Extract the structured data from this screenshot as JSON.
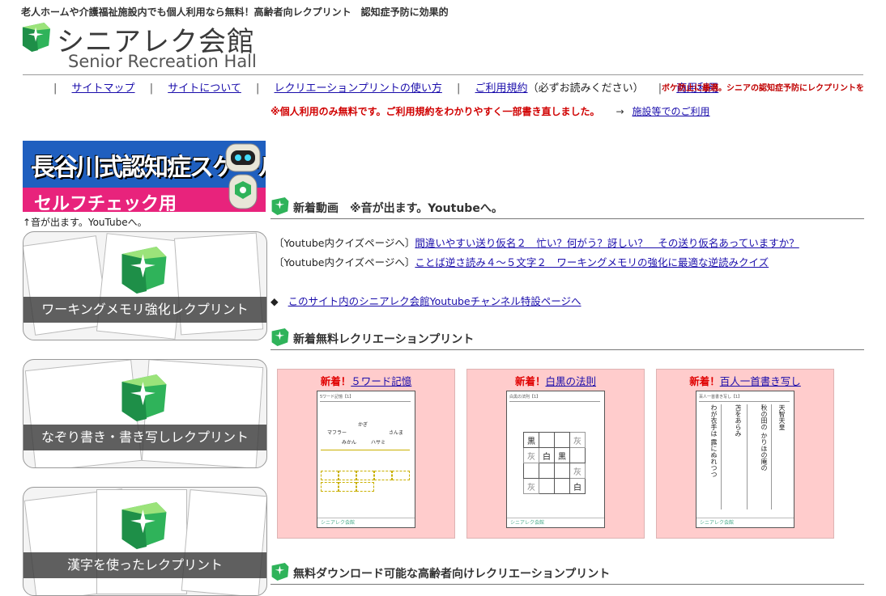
{
  "header": {
    "tagline": "老人ホームや介護福祉施設内でも個人利用なら無料！高齢者向レクプリント　認知症予防に効果的",
    "logo_title": "シニアレク会館",
    "logo_sub": "Senior Recreation Hall"
  },
  "nav": {
    "items": [
      {
        "label": "サイトマップ"
      },
      {
        "label": "サイトについて"
      },
      {
        "label": "レクリエーションプリントの使い方"
      },
      {
        "label": "ご利用規約",
        "note": "（必ずお読みください）"
      },
      {
        "label": "商用利用"
      }
    ],
    "notice_red": "ボケ防止に最適。シニアの認知症予防にレクプリントを",
    "notice2_red": "※個人利用のみ無料です。ご利用規約をわかりやすく一部書き直しました。",
    "notice2_arrow": "→",
    "notice2_link": "施設等でのご利用"
  },
  "sidebar": {
    "hasegawa_title": "長谷川式認知症スケール",
    "hasegawa_sub": "セルフチェック用",
    "yt_caption": "↑音が出ます。YouTubeへ。",
    "banners": [
      {
        "label": "ワーキングメモリ強化レクプリント"
      },
      {
        "label": "なぞり書き・書き写しレクプリント"
      },
      {
        "label": "漢字を使ったレクプリント"
      }
    ]
  },
  "main": {
    "section_video": "新着動画　※音が出ます。Youtubeへ。",
    "videos": [
      {
        "prefix": "〔Youtube内クイズページへ〕",
        "link": "間違いやすい送り仮名２　忙い？何がう？訝しい？　その送り仮名あっていますか？"
      },
      {
        "prefix": "〔Youtube内クイズページへ〕",
        "link": "ことば逆さ読み４～５文字２　ワーキングメモリの強化に最適な逆読みクイズ"
      }
    ],
    "yt_channel_bullet": "◆",
    "yt_channel_link": "このサイト内のシニアレク会館Youtubeチャンネル特設ページへ",
    "section_new_prints": "新着無料レクリエーションプリント",
    "cards": [
      {
        "new": "新着！",
        "link": "５ワード記憶"
      },
      {
        "new": "新着！",
        "link": "白黒の法則"
      },
      {
        "new": "新着！",
        "link": "百人一首書き写し"
      }
    ],
    "section_download": "無料ダウンロード可能な高齢者向けレクリエーションプリント"
  },
  "sheets": {
    "s1_words": [
      "かぎ",
      "マフラー",
      "さんま",
      "みかん",
      "ハサミ"
    ],
    "s1_hdr": "5ワード記憶【1】",
    "s2_hdr": "白黒の法則【1】",
    "s2_cells": [
      "黒",
      "",
      "",
      "灰",
      "灰",
      "白",
      "黒",
      "",
      "",
      "",
      "",
      "灰",
      "灰",
      "",
      "",
      "白"
    ],
    "s3_hdr": "百人一首書き写し【1】",
    "s3_cols": [
      "天智天皇",
      "秋の田の かりほの庵の",
      "苫をあらみ",
      "わが衣手は 露にぬれつつ"
    ],
    "footer": "シニアレク会館"
  },
  "colors": {
    "accent_green": "#2fb35a",
    "link": "#1a0dab",
    "notice_red": "#c00000",
    "card_bg": "#ffcccc"
  }
}
